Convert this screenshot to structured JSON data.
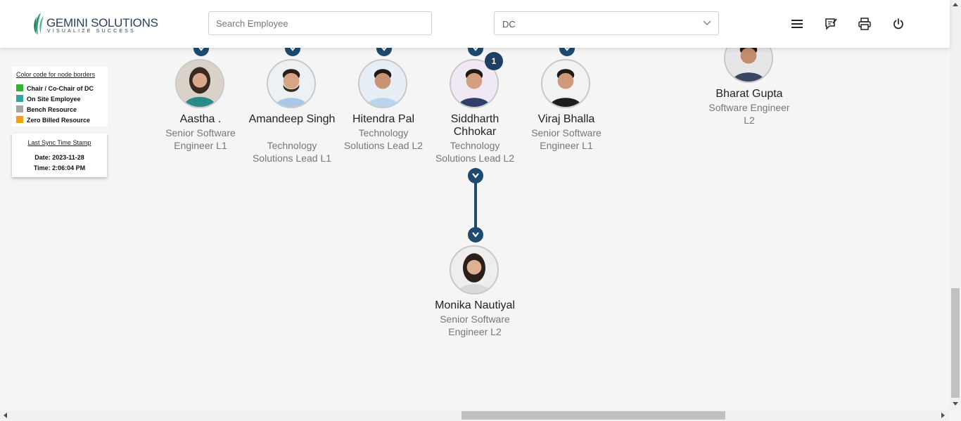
{
  "header": {
    "brand_name": "GEMINI SOLUTIONS",
    "brand_tagline": "VISUALIZE SUCCESS",
    "search_placeholder": "Search Employee",
    "department_value": "DC",
    "icons": [
      "menu-icon",
      "feedback-icon",
      "print-icon",
      "power-icon"
    ]
  },
  "legend": {
    "title": "Color code for node borders",
    "items": [
      {
        "label": "Chair / Co-Chair of DC",
        "color": "#2db52d"
      },
      {
        "label": "On Site Employee",
        "color": "#2ea6a6"
      },
      {
        "label": "Bench Resource",
        "color": "#a6a6a6"
      },
      {
        "label": "Zero Billed Resource",
        "color": "#f0a30a"
      }
    ]
  },
  "sync": {
    "title": "Last Sync Time Stamp",
    "date": "Date: 2023-11-28",
    "time": "Time: 2:06:04 PM"
  },
  "employees": [
    {
      "name": "Aastha .",
      "title": "Senior Software Engineer L1"
    },
    {
      "name": "Amandeep Singh",
      "title": "Technology Solutions Lead L1"
    },
    {
      "name": "Hitendra Pal",
      "title": "Technology Solutions Lead L2"
    },
    {
      "name": "Siddharth Chhokar",
      "title": "Technology Solutions Lead L2",
      "report_count": "1"
    },
    {
      "name": "Viraj Bhalla",
      "title": "Senior Software Engineer L1"
    },
    {
      "name": "Bharat Gupta",
      "title": "Software Engineer L2"
    },
    {
      "name": "Monika Nautiyal",
      "title": "Senior Software Engineer L2"
    }
  ],
  "colors": {
    "accent": "#1d4a6e",
    "badge": "#1d3f66",
    "brand": "#2b3f5c",
    "brand_leaf": "#2e9a6e"
  }
}
